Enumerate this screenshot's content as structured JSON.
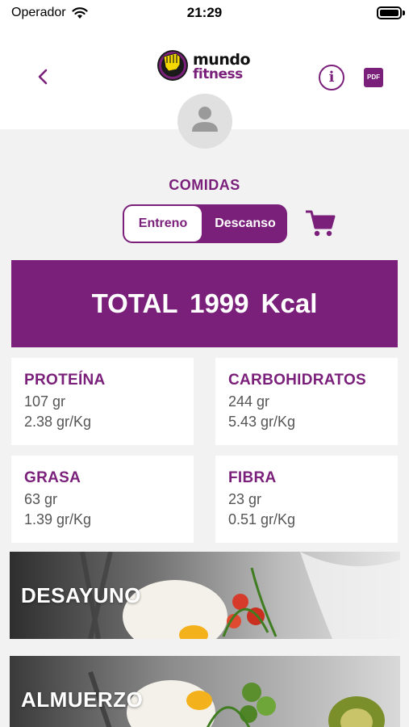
{
  "status_bar": {
    "carrier": "Operador",
    "time": "21:29"
  },
  "header": {
    "logo_line1": "mundo",
    "logo_line2": "fitness"
  },
  "section_title": "COMIDAS",
  "segment": {
    "left_label": "Entreno",
    "right_label": "Descanso",
    "selected": "Entreno"
  },
  "total": "TOTAL  1999 Kcal",
  "macros": [
    {
      "title": "PROTEÍNA",
      "grams": "107 gr",
      "per_kg": "2.38 gr/Kg"
    },
    {
      "title": "CARBOHIDRATOS",
      "grams": "244 gr",
      "per_kg": "5.43 gr/Kg"
    },
    {
      "title": "GRASA",
      "grams": "63 gr",
      "per_kg": "1.39 gr/Kg"
    },
    {
      "title": "FIBRA",
      "grams": "23 gr",
      "per_kg": "0.51 gr/Kg"
    }
  ],
  "meals": [
    {
      "label": "DESAYUNO"
    },
    {
      "label": "ALMUERZO"
    }
  ],
  "colors": {
    "brand": "#7a1f7a",
    "background": "#f2f2f2",
    "logo_yellow": "#f5d800"
  },
  "icons": [
    "wifi-icon",
    "battery-icon",
    "chevron-left-icon",
    "info-icon",
    "pdf-icon",
    "user-icon",
    "shopping-cart-icon",
    "fist-icon"
  ]
}
